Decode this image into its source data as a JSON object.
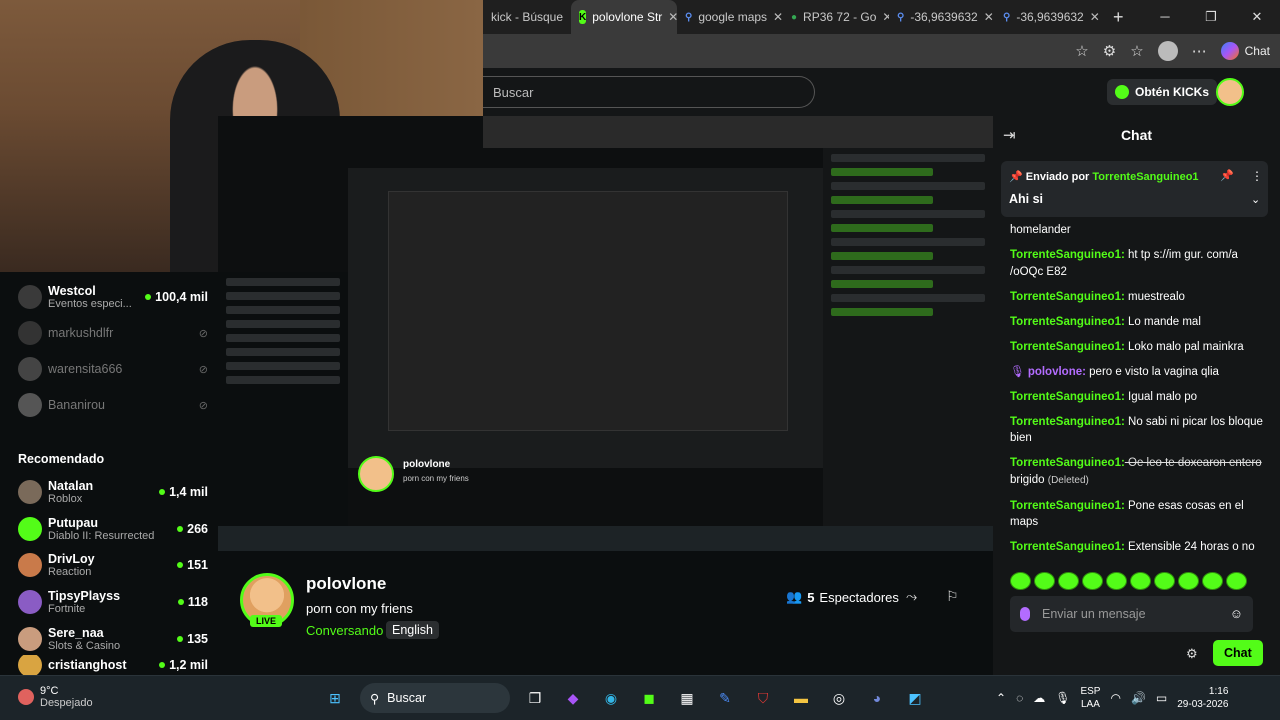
{
  "browser": {
    "tabs": [
      {
        "label": "kick - Búsque",
        "icon": "search-icon",
        "icon_color": "#5b8def"
      },
      {
        "label": "polovlone Str",
        "icon": "kick-logo-icon",
        "icon_color": "#53fc18",
        "active": true
      },
      {
        "label": "google maps",
        "icon": "search-icon",
        "icon_color": "#5b8def"
      },
      {
        "label": "RP36 72 - Go",
        "icon": "map-pin-icon",
        "icon_color": "#34a853"
      },
      {
        "label": "-36,9639632",
        "icon": "search-icon",
        "icon_color": "#5b8def"
      },
      {
        "label": "-36,9639632",
        "icon": "search-icon",
        "icon_color": "#5b8def"
      }
    ],
    "copilot_label": "Chat"
  },
  "kick": {
    "search_placeholder": "Buscar",
    "kicks_button": "Obtén KICKs"
  },
  "sidebar": {
    "following": [
      {
        "name": "Westcol",
        "sub": "Eventos especi...",
        "count": "100,4 mil",
        "live": true
      },
      {
        "name": "markushdlfr",
        "live": false
      },
      {
        "name": "warensita666",
        "live": false
      },
      {
        "name": "Bananirou",
        "live": false
      }
    ],
    "recommended_title": "Recomendado",
    "recommended": [
      {
        "name": "Natalan",
        "sub": "Roblox",
        "count": "1,4 mil"
      },
      {
        "name": "Putupau",
        "sub": "Diablo II: Resurrected",
        "count": "266"
      },
      {
        "name": "DrivLoy",
        "sub": "Reaction",
        "count": "151"
      },
      {
        "name": "TipsyPlayss",
        "sub": "Fortnite",
        "count": "118"
      },
      {
        "name": "Sere_naa",
        "sub": "Slots & Casino",
        "count": "135"
      },
      {
        "name": "cristianghost",
        "sub": "",
        "count": "1,2 mil"
      }
    ]
  },
  "stream": {
    "mini_title": "polovlone",
    "mini_subtitle": "porn con my friens"
  },
  "info": {
    "streamer": "polovlone",
    "live_badge": "LIVE",
    "title": "porn con my friens",
    "category": "Conversando",
    "language": "English",
    "viewers_count": "5",
    "viewers_label": "Espectadores"
  },
  "chat": {
    "title": "Chat",
    "pinned_prefix": "Enviado por",
    "pinned_user": "TorrenteSanguineo1",
    "pinned_message": "Ahi si",
    "messages": [
      {
        "user": "",
        "text": "homelander"
      },
      {
        "user": "TorrenteSanguineo1:",
        "text": " ht tp s://im gur. com/a /oOQc E82"
      },
      {
        "user": "TorrenteSanguineo1:",
        "text": " muestrealo"
      },
      {
        "user": "TorrenteSanguineo1:",
        "text": " Lo mande mal"
      },
      {
        "user": "TorrenteSanguineo1:",
        "text": " Loko malo pal mainkra"
      },
      {
        "user": "polovlone:",
        "text": " pero e visto la vagina qlia",
        "mod": true
      },
      {
        "user": "TorrenteSanguineo1:",
        "text": " Igual malo po"
      },
      {
        "user": "TorrenteSanguineo1:",
        "text": " No sabi ni picar los bloque bien"
      },
      {
        "user": "TorrenteSanguineo1:",
        "text": " Oe leo te doxearon entero",
        "deleted_suffix": "brigido",
        "deleted_tag": "(Deleted)"
      },
      {
        "user": "TorrenteSanguineo1:",
        "text": " Pone esas cosas en el maps"
      },
      {
        "user": "TorrenteSanguineo1:",
        "text": " Extensible 24 horas o no"
      }
    ],
    "input_placeholder": "Enviar un mensaje",
    "send_label": "Chat"
  },
  "taskbar": {
    "temperature": "9°C",
    "weather": "Despejado",
    "search_label": "Buscar",
    "lang_1": "ESP",
    "lang_2": "LAA",
    "time": "1:16",
    "date": "29-03-2026"
  },
  "colors": {
    "accent": "#53fc18",
    "mod_user": "#b36cff"
  }
}
